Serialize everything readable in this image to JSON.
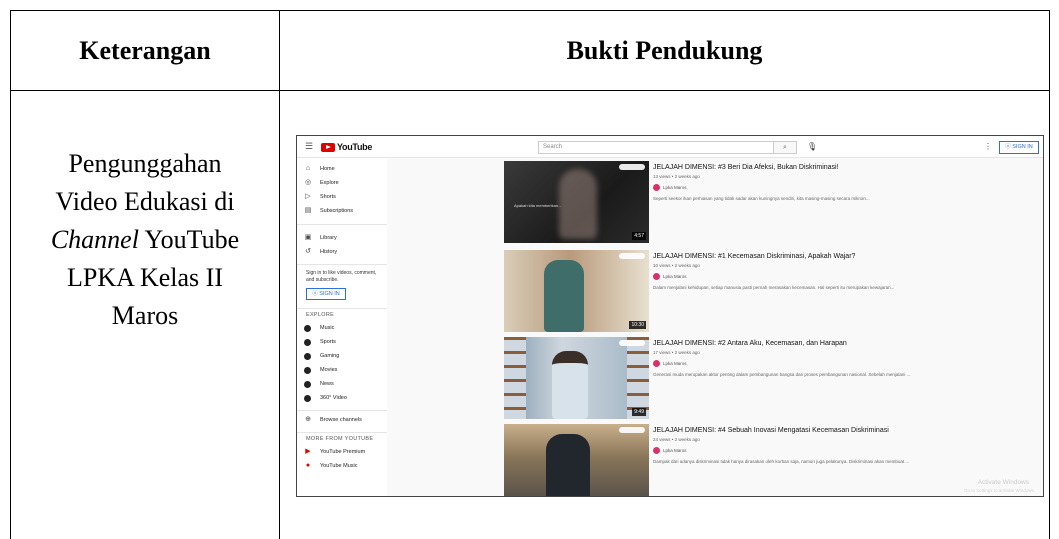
{
  "table": {
    "header_left": "Keterangan",
    "header_right": "Bukti Pendukung",
    "desc_line1": "Pengunggahan",
    "desc_line2": "Video Edukasi di",
    "desc_line3_italic": "Channel",
    "desc_line3_rest": " YouTube",
    "desc_line4": "LPKA Kelas II",
    "desc_line5": "Maros"
  },
  "youtube": {
    "logo_text": "YouTube",
    "search_placeholder": "Search",
    "sign_in": "SIGN IN",
    "sidebar": {
      "items": [
        {
          "label": "Home",
          "icon": "home-icon"
        },
        {
          "label": "Explore",
          "icon": "compass-icon"
        },
        {
          "label": "Shorts",
          "icon": "shorts-icon"
        },
        {
          "label": "Subscriptions",
          "icon": "subscriptions-icon"
        },
        {
          "label": "Library",
          "icon": "library-icon"
        },
        {
          "label": "History",
          "icon": "history-icon"
        }
      ],
      "signin_note": "Sign in to like videos, comment, and subscribe.",
      "signin_button": "SIGN IN",
      "explore_header": "EXPLORE",
      "explore_items": [
        "Music",
        "Sports",
        "Gaming",
        "Movies",
        "News",
        "360° Video"
      ],
      "browse_channels": "Browse channels",
      "more_header": "MORE FROM YOUTUBE",
      "more_items": [
        "YouTube Premium",
        "YouTube Music"
      ]
    },
    "videos": [
      {
        "title": "JELAJAH DIMENSI: #3 Beri Dia Afeksi, Bukan Diskriminasi!",
        "meta": "13 views • 2 weeks ago",
        "channel": "Lpka Maros",
        "desc": "Seperti seekor ikan perhiasan yang tidak sadar akan kuningnya sendiri, kita masing-masing secara mikroin...",
        "duration": "4:57",
        "thumb_text": "Apakah kita memberikan..."
      },
      {
        "title": "JELAJAH DIMENSI: #1 Kecemasan Diskriminasi, Apakah Wajar?",
        "meta": "10 views • 2 weeks ago",
        "channel": "Lpka Maros",
        "desc": "Dalam menjalani kehidupan, setiap manusia pasti pernah merasakan kecemasan. Hal seperti itu merupakan kewajaran...",
        "duration": "10:30"
      },
      {
        "title": "JELAJAH DIMENSI: #2 Antara Aku, Kecemasan, dan Harapan",
        "meta": "17 views • 2 weeks ago",
        "channel": "Lpka Maros",
        "desc": "Generasi muda merupakan aktor penting dalam pembangunan bangsa dan proses pembangunan nasional. Sebelah menjalani ...",
        "duration": "9:49"
      },
      {
        "title": "JELAJAH DIMENSI: #4 Sebuah Inovasi Mengatasi Kecemasan Diskriminasi",
        "meta": "24 views • 2 weeks ago",
        "channel": "Lpka Maros",
        "desc": "Dampak dari adanya diskriminasi tidak hanya dirasakan oleh korban saja, namun juga pelakunya. Diskriminasi akan membuat ...",
        "duration": ""
      }
    ],
    "watermark_title": "Activate Windows",
    "watermark_sub": "Go to Settings to activate Windows."
  }
}
